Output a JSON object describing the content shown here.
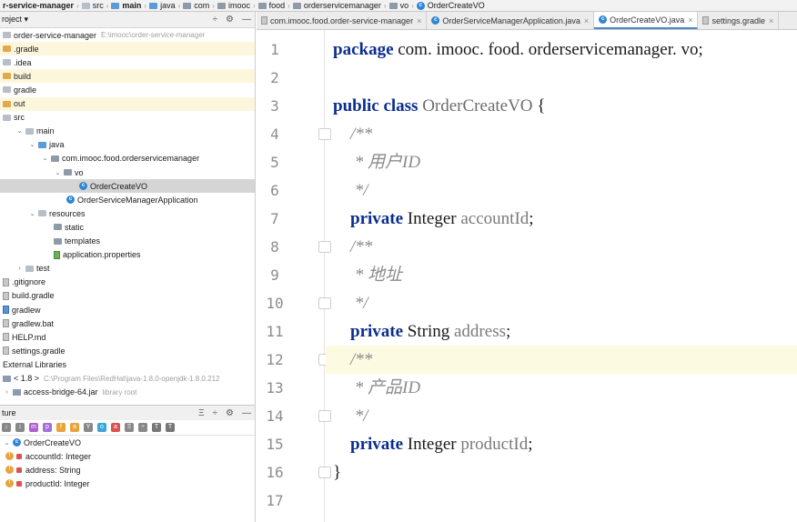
{
  "breadcrumb": [
    {
      "label": "r-service-manager",
      "icon": "none",
      "bold": true
    },
    {
      "label": "src",
      "icon": "folder-plain"
    },
    {
      "label": "main",
      "icon": "folder-blue",
      "bold": true
    },
    {
      "label": "java",
      "icon": "folder-blue"
    },
    {
      "label": "com",
      "icon": "package"
    },
    {
      "label": "imooc",
      "icon": "package"
    },
    {
      "label": "food",
      "icon": "package"
    },
    {
      "label": "orderservicemanager",
      "icon": "package"
    },
    {
      "label": "vo",
      "icon": "package"
    },
    {
      "label": "OrderCreateVO",
      "icon": "class"
    }
  ],
  "project_panel": {
    "title": "roject ▾",
    "tools": [
      "÷",
      "⚙",
      "—"
    ],
    "tree": [
      {
        "label": "order-service-manager",
        "extra": "E:\\imooc\\order-service-manager",
        "icon": "folder-plain",
        "indent": 0,
        "arrow": "",
        "style": ""
      },
      {
        "label": ".gradle",
        "icon": "folder-orange",
        "indent": 0,
        "arrow": "",
        "style": "yellow"
      },
      {
        "label": ".idea",
        "icon": "folder-plain",
        "indent": 0,
        "arrow": "",
        "style": ""
      },
      {
        "label": "build",
        "icon": "folder-orange",
        "indent": 0,
        "arrow": "",
        "style": "yellow"
      },
      {
        "label": "gradle",
        "icon": "folder-plain",
        "indent": 0,
        "arrow": "",
        "style": ""
      },
      {
        "label": "out",
        "icon": "folder-orange",
        "indent": 0,
        "arrow": "",
        "style": "yellow"
      },
      {
        "label": "src",
        "icon": "folder-plain",
        "indent": 0,
        "arrow": "",
        "style": ""
      },
      {
        "label": "main",
        "icon": "folder-plain",
        "indent": 1,
        "arrow": "v",
        "style": ""
      },
      {
        "label": "java",
        "icon": "folder-blue",
        "indent": 2,
        "arrow": "v",
        "style": ""
      },
      {
        "label": "com.imooc.food.orderservicemanager",
        "icon": "package",
        "indent": 3,
        "arrow": "v",
        "style": ""
      },
      {
        "label": "vo",
        "icon": "package",
        "indent": 4,
        "arrow": "v",
        "style": ""
      },
      {
        "label": "OrderCreateVO",
        "icon": "class",
        "indent": 6,
        "arrow": "",
        "style": "sel"
      },
      {
        "label": "OrderServiceManagerApplication",
        "icon": "class",
        "indent": 5,
        "arrow": "",
        "style": ""
      },
      {
        "label": "resources",
        "icon": "folder-plain",
        "indent": 2,
        "arrow": "v",
        "style": ""
      },
      {
        "label": "static",
        "icon": "package",
        "indent": 4,
        "arrow": "",
        "style": ""
      },
      {
        "label": "templates",
        "icon": "package",
        "indent": 4,
        "arrow": "",
        "style": ""
      },
      {
        "label": "application.properties",
        "icon": "file-green",
        "indent": 4,
        "arrow": "",
        "style": ""
      },
      {
        "label": "test",
        "icon": "folder-plain",
        "indent": 1,
        "arrow": ">",
        "style": ""
      },
      {
        "label": ".gitignore",
        "icon": "file",
        "indent": 0,
        "arrow": "",
        "style": ""
      },
      {
        "label": "build.gradle",
        "icon": "file",
        "indent": 0,
        "arrow": "",
        "style": ""
      },
      {
        "label": "gradlew",
        "icon": "file-blue",
        "indent": 0,
        "arrow": "",
        "style": ""
      },
      {
        "label": "gradlew.bat",
        "icon": "file",
        "indent": 0,
        "arrow": "",
        "style": ""
      },
      {
        "label": "HELP.md",
        "icon": "file",
        "indent": 0,
        "arrow": "",
        "style": ""
      },
      {
        "label": "settings.gradle",
        "icon": "file",
        "indent": 0,
        "arrow": "",
        "style": ""
      },
      {
        "label": "External Libraries",
        "icon": "none",
        "indent": 0,
        "arrow": "",
        "style": ""
      },
      {
        "label": "< 1.8 >",
        "extra": "C:\\Program Files\\RedHat\\java-1.8.0-openjdk-1.8.0.212",
        "icon": "lib",
        "indent": 0,
        "arrow": "",
        "style": ""
      },
      {
        "label": "access-bridge-64.jar",
        "extra": "library root",
        "icon": "lib",
        "indent": 0,
        "arrow": ">",
        "style": ""
      }
    ]
  },
  "structure_panel": {
    "title": "ture",
    "tools": [
      "Ξ",
      "÷",
      "⚙",
      "—"
    ],
    "toolbar": [
      {
        "label": "↓",
        "color": "#888888"
      },
      {
        "label": "↕",
        "color": "#888888"
      },
      {
        "label": "m",
        "color": "#b05fd0"
      },
      {
        "label": "p",
        "color": "#a06fd8"
      },
      {
        "label": "f",
        "color": "#e8a33a"
      },
      {
        "label": "a",
        "color": "#e8a33a"
      },
      {
        "label": "Y",
        "color": "#888888"
      },
      {
        "label": "o",
        "color": "#3ba7d8"
      },
      {
        "label": "a",
        "color": "#d9534f"
      },
      {
        "label": "Ξ",
        "color": "#888888"
      },
      {
        "label": "÷",
        "color": "#888888"
      },
      {
        "label": "T",
        "color": "#777777"
      },
      {
        "label": "T",
        "color": "#777777"
      }
    ],
    "items": [
      {
        "label": "OrderCreateVO",
        "type": "class"
      },
      {
        "label": "accountId: Integer",
        "type": "field"
      },
      {
        "label": "address: String",
        "type": "field"
      },
      {
        "label": "productId: Integer",
        "type": "field"
      }
    ]
  },
  "editor_tabs": [
    {
      "label": "com.imooc.food.order-service-manager",
      "icon": "gradle",
      "active": false
    },
    {
      "label": "OrderServiceManagerApplication.java",
      "icon": "class",
      "active": false
    },
    {
      "label": "OrderCreateVO.java",
      "icon": "class",
      "active": true
    },
    {
      "label": "settings.gradle",
      "icon": "gradle",
      "active": false
    }
  ],
  "editor": {
    "line_numbers": [
      "1",
      "2",
      "3",
      "4",
      "5",
      "6",
      "7",
      "8",
      "9",
      "10",
      "11",
      "12",
      "13",
      "14",
      "15",
      "16",
      "17"
    ],
    "highlighted_line": 12,
    "lines": [
      [
        {
          "t": "package ",
          "c": "kw"
        },
        {
          "t": "com. imooc. food. orderservicemanager. vo;",
          "c": ""
        }
      ],
      [],
      [
        {
          "t": "public class ",
          "c": "kw"
        },
        {
          "t": "OrderCreateVO",
          "c": "cls"
        },
        {
          "t": " {",
          "c": ""
        }
      ],
      [
        {
          "t": "    /**",
          "c": "cm"
        }
      ],
      [
        {
          "t": "     * 用户ID",
          "c": "cm"
        }
      ],
      [
        {
          "t": "     */",
          "c": "cm"
        }
      ],
      [
        {
          "t": "    private ",
          "c": "kw"
        },
        {
          "t": "Integer ",
          "c": ""
        },
        {
          "t": "accountId",
          "c": "fld"
        },
        {
          "t": ";",
          "c": ""
        }
      ],
      [
        {
          "t": "    /**",
          "c": "cm"
        }
      ],
      [
        {
          "t": "     * 地址",
          "c": "cm"
        }
      ],
      [
        {
          "t": "     */",
          "c": "cm"
        }
      ],
      [
        {
          "t": "    private ",
          "c": "kw"
        },
        {
          "t": "String ",
          "c": ""
        },
        {
          "t": "address",
          "c": "fld"
        },
        {
          "t": ";",
          "c": ""
        }
      ],
      [
        {
          "t": "    /**",
          "c": "cm"
        }
      ],
      [
        {
          "t": "     * 产品ID",
          "c": "cm"
        }
      ],
      [
        {
          "t": "     */",
          "c": "cm"
        }
      ],
      [
        {
          "t": "    private ",
          "c": "kw"
        },
        {
          "t": "Integer ",
          "c": ""
        },
        {
          "t": "productId",
          "c": "fld"
        },
        {
          "t": ";",
          "c": ""
        }
      ],
      [
        {
          "t": "}",
          "c": ""
        }
      ],
      []
    ]
  }
}
